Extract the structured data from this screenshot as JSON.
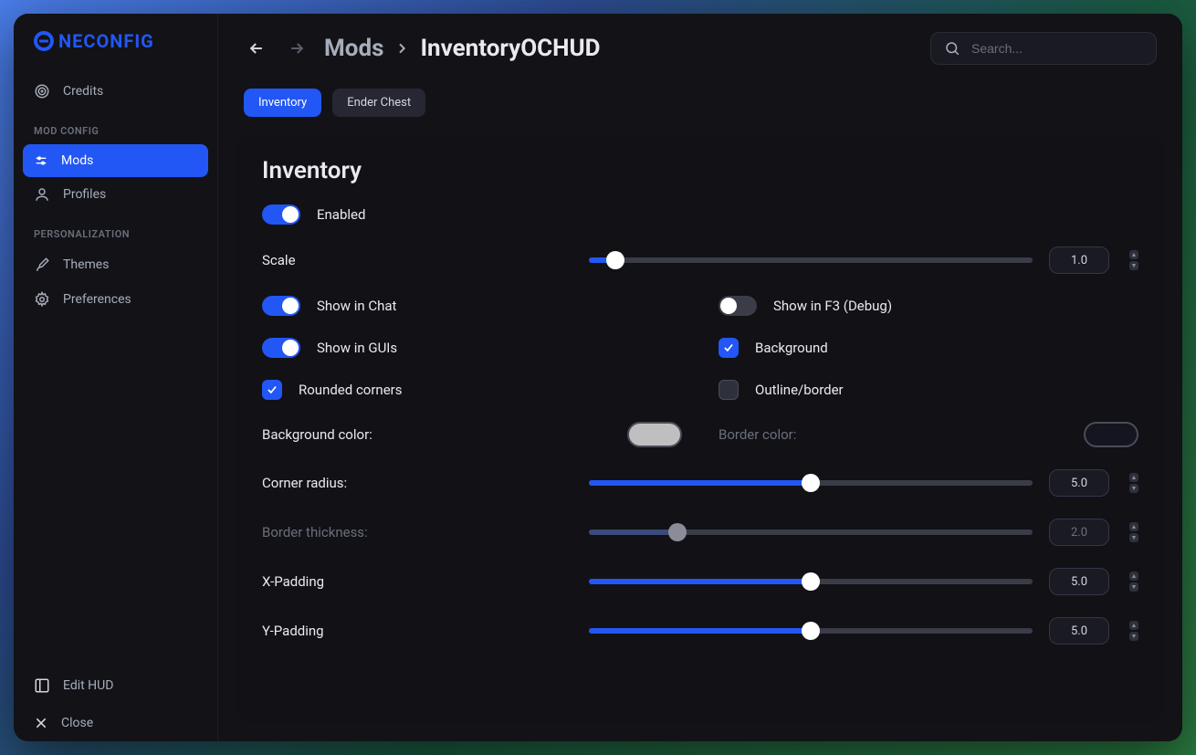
{
  "app": {
    "logo_text": "NECONFIG"
  },
  "sidebar": {
    "credits": "Credits",
    "section_mod": "MOD CONFIG",
    "mods": "Mods",
    "profiles": "Profiles",
    "section_personal": "PERSONALIZATION",
    "themes": "Themes",
    "preferences": "Preferences",
    "edit_hud": "Edit HUD",
    "close": "Close"
  },
  "breadcrumb": {
    "root": "Mods",
    "leaf": "InventoryOCHUD"
  },
  "search": {
    "placeholder": "Search..."
  },
  "tabs": [
    {
      "label": "Inventory",
      "active": true
    },
    {
      "label": "Ender Chest",
      "active": false
    }
  ],
  "panel": {
    "title": "Inventory",
    "enabled_label": "Enabled",
    "scale_label": "Scale",
    "scale_value": "1.0",
    "scale_pct": 6,
    "show_in_chat": "Show in Chat",
    "show_in_f3": "Show in F3 (Debug)",
    "show_in_guis": "Show in GUIs",
    "background": "Background",
    "rounded_corners": "Rounded corners",
    "outline_border": "Outline/border",
    "bg_color_label": "Background color:",
    "border_color_label": "Border color:",
    "bg_color": "#bfbfbf",
    "border_color": "#151520",
    "corner_radius_label": "Corner radius:",
    "corner_radius_value": "5.0",
    "corner_radius_pct": 50,
    "border_thickness_label": "Border thickness:",
    "border_thickness_value": "2.0",
    "border_thickness_pct": 20,
    "x_padding_label": "X-Padding",
    "x_padding_value": "5.0",
    "x_padding_pct": 50,
    "y_padding_label": "Y-Padding",
    "y_padding_value": "5.0",
    "y_padding_pct": 50
  }
}
